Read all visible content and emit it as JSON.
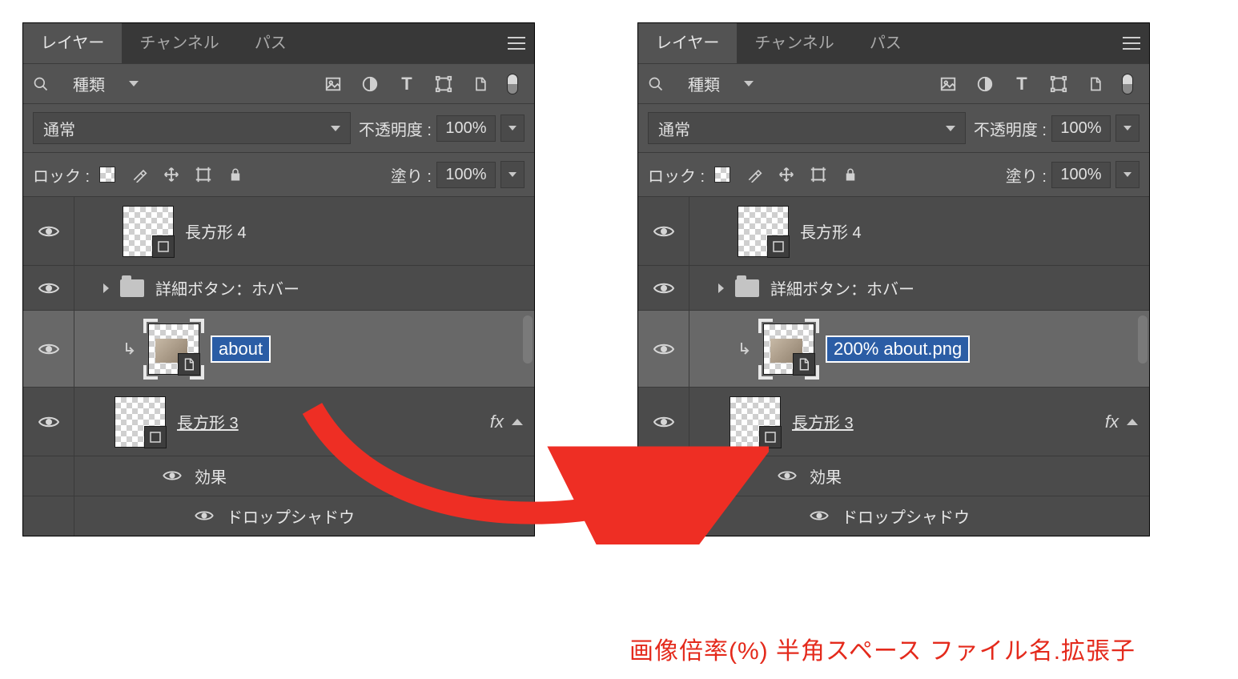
{
  "tabs": {
    "layers": "レイヤー",
    "channels": "チャンネル",
    "paths": "パス"
  },
  "filter": {
    "search_label": "種類"
  },
  "blend": {
    "mode": "通常",
    "opacity_label": "不透明度 :",
    "opacity_value": "100%"
  },
  "lock": {
    "label": "ロック :",
    "fill_label": "塗り :",
    "fill_value": "100%"
  },
  "layers_left": {
    "rect4": "長方形 4",
    "group": "詳細ボタン：ホバー",
    "rename": "about",
    "rect3": "長方形 3",
    "effects_label": "効果",
    "drop_shadow": "ドロップシャドウ",
    "fx": "fx"
  },
  "layers_right": {
    "rect4": "長方形 4",
    "group": "詳細ボタン：ホバー",
    "rename": "200% about.png",
    "rect3": "長方形 3",
    "effects_label": "効果",
    "drop_shadow": "ドロップシャドウ",
    "fx": "fx"
  },
  "caption": "画像倍率(%) 半角スペース ファイル名.拡張子"
}
